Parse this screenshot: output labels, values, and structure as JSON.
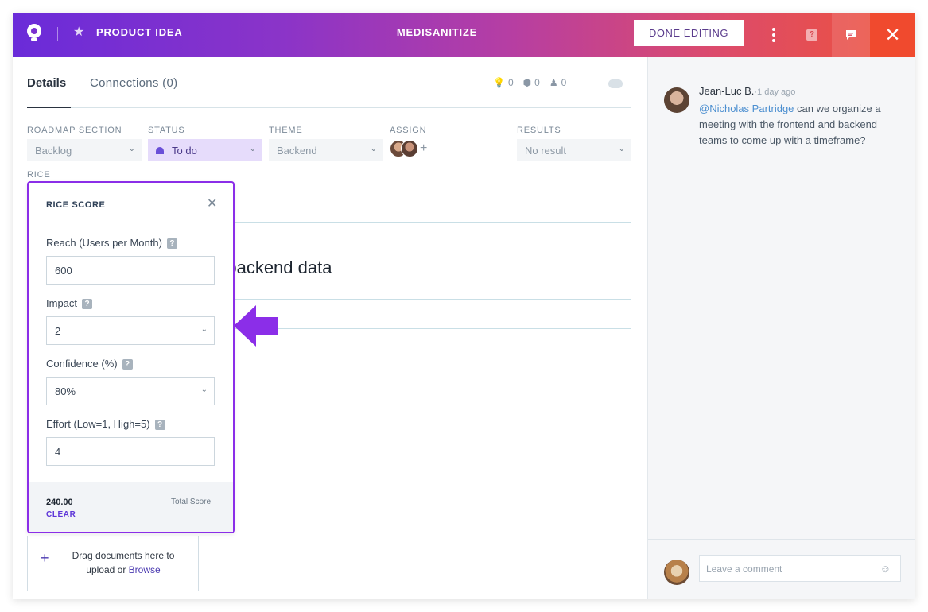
{
  "header": {
    "breadcrumb": "PRODUCT IDEA",
    "title": "MEDISANITIZE",
    "done_label": "DONE EDITING",
    "close_glyph": "✕",
    "help_glyph": "?"
  },
  "tabs": {
    "details": "Details",
    "connections": "Connections (0)"
  },
  "counts": {
    "ideas": "0",
    "features": "0",
    "votes": "0"
  },
  "fields": {
    "roadmap": {
      "label": "ROADMAP SECTION",
      "value": "Backlog"
    },
    "status": {
      "label": "STATUS",
      "value": "To do"
    },
    "theme": {
      "label": "THEME",
      "value": "Backend"
    },
    "assign": {
      "label": "ASSIGN"
    },
    "results": {
      "label": "RESULTS",
      "value": "No result"
    },
    "rice": {
      "label": "RICE"
    }
  },
  "card": {
    "title_visible": "h backend data"
  },
  "rice_popup": {
    "title": "RICE SCORE",
    "reach_label": "Reach (Users per Month)",
    "reach_value": "600",
    "impact_label": "Impact",
    "impact_value": "2",
    "confidence_label": "Confidence (%)",
    "confidence_value": "80%",
    "effort_label": "Effort (Low=1, High=5)",
    "effort_value": "4",
    "score": "240.00",
    "clear_label": "CLEAR",
    "total_label": "Total Score"
  },
  "upload": {
    "text": "Drag documents here to upload or ",
    "browse": "Browse"
  },
  "comments": [
    {
      "author": "Jean-Luc B.",
      "time": "·1 day ago",
      "mention": "@Nicholas Partridge",
      "text": " can we organize a meeting with the frontend and backend teams to come up with a timeframe?"
    }
  ],
  "comment_input": {
    "placeholder": "Leave a comment"
  },
  "colors": {
    "accent": "#8b2ee8",
    "header_start": "#6a2bd9",
    "header_end": "#ef5238"
  }
}
